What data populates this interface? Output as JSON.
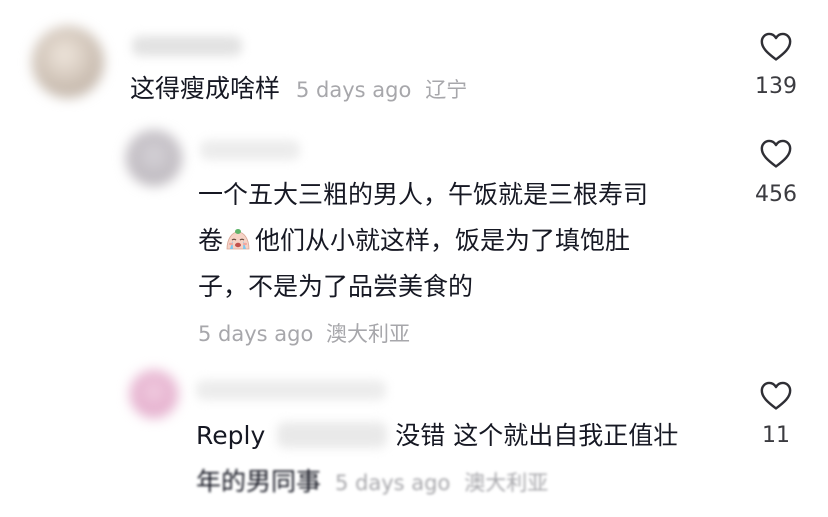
{
  "comments": [
    {
      "text": "这得瘦成啥样",
      "time": "5 days ago",
      "location": "辽宁",
      "likes": "139"
    },
    {
      "lines": [
        "一个五大三粗的男人，午饭就是三根寿司",
        "他们从小就这样，饭是为了填饱肚",
        "子，不是为了品尝美食的"
      ],
      "line2_prefix": "卷",
      "emoji": "crying-face-emoji",
      "time": "5 days ago",
      "location": "澳大利亚",
      "likes": "456"
    },
    {
      "reply_label": "Reply",
      "text_line1": "没错 这个就出自我正值壮",
      "text_line2": "年的男同事",
      "time": "5 days ago",
      "location": "澳大利亚",
      "likes": "11"
    }
  ],
  "icons": {
    "like": "heart-outline-icon"
  },
  "colors": {
    "text": "#161823",
    "meta": "#a7a7ab",
    "count": "#3b3b40"
  }
}
